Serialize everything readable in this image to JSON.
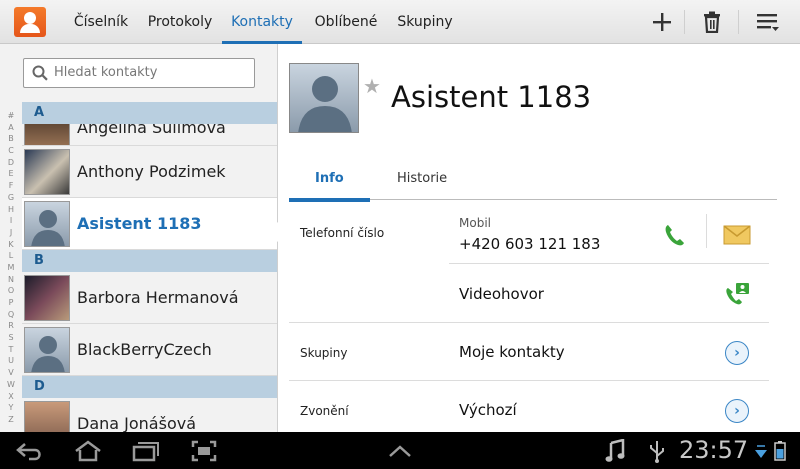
{
  "topbar": {
    "tabs": [
      {
        "label": "Číselník"
      },
      {
        "label": "Protokoly"
      },
      {
        "label": "Kontakty"
      },
      {
        "label": "Oblíbené"
      },
      {
        "label": "Skupiny"
      }
    ],
    "active_tab": "Kontakty",
    "icons": [
      "contacts-app-icon",
      "add-icon",
      "delete-icon",
      "menu-icon"
    ]
  },
  "search": {
    "placeholder": "Hledat kontakty"
  },
  "alphabet": [
    "#",
    "A",
    "B",
    "C",
    "D",
    "E",
    "F",
    "G",
    "H",
    "I",
    "J",
    "K",
    "L",
    "M",
    "N",
    "O",
    "P",
    "Q",
    "R",
    "S",
    "T",
    "U",
    "V",
    "W",
    "X",
    "Y",
    "Z"
  ],
  "contacts": {
    "sections": [
      "A",
      "B",
      "D"
    ],
    "items": [
      {
        "name": "Angelina Sulimova",
        "section": "A"
      },
      {
        "name": "Anthony Podzimek",
        "section": "A"
      },
      {
        "name": "Asistent 1183",
        "section": "A",
        "selected": true
      },
      {
        "name": "Barbora Hermanová",
        "section": "B"
      },
      {
        "name": "BlackBerryCzech",
        "section": "B"
      },
      {
        "name": "Dana Jonášová",
        "section": "D"
      }
    ]
  },
  "detail": {
    "name": "Asistent 1183",
    "tabs": [
      "Info",
      "Historie"
    ],
    "active_tab": "Info",
    "phone_label": "Telefonní číslo",
    "phone_type": "Mobil",
    "phone_number": "+420 603 121 183",
    "video_call": "Videohovor",
    "groups_label": "Skupiny",
    "groups_value": "Moje kontakty",
    "ringtone_label": "Zvonění",
    "ringtone_value": "Výchozí",
    "colors": {
      "accent": "#1e6fb5",
      "call_green": "#3aa43a",
      "message_yellow": "#e8b84a"
    }
  },
  "system_bar": {
    "clock": "23:57",
    "icons": [
      "back-icon",
      "home-icon",
      "recent-apps-icon",
      "screenshot-icon",
      "up-arrow-icon",
      "music-icon",
      "usb-icon",
      "wifi-icon",
      "battery-icon"
    ]
  }
}
